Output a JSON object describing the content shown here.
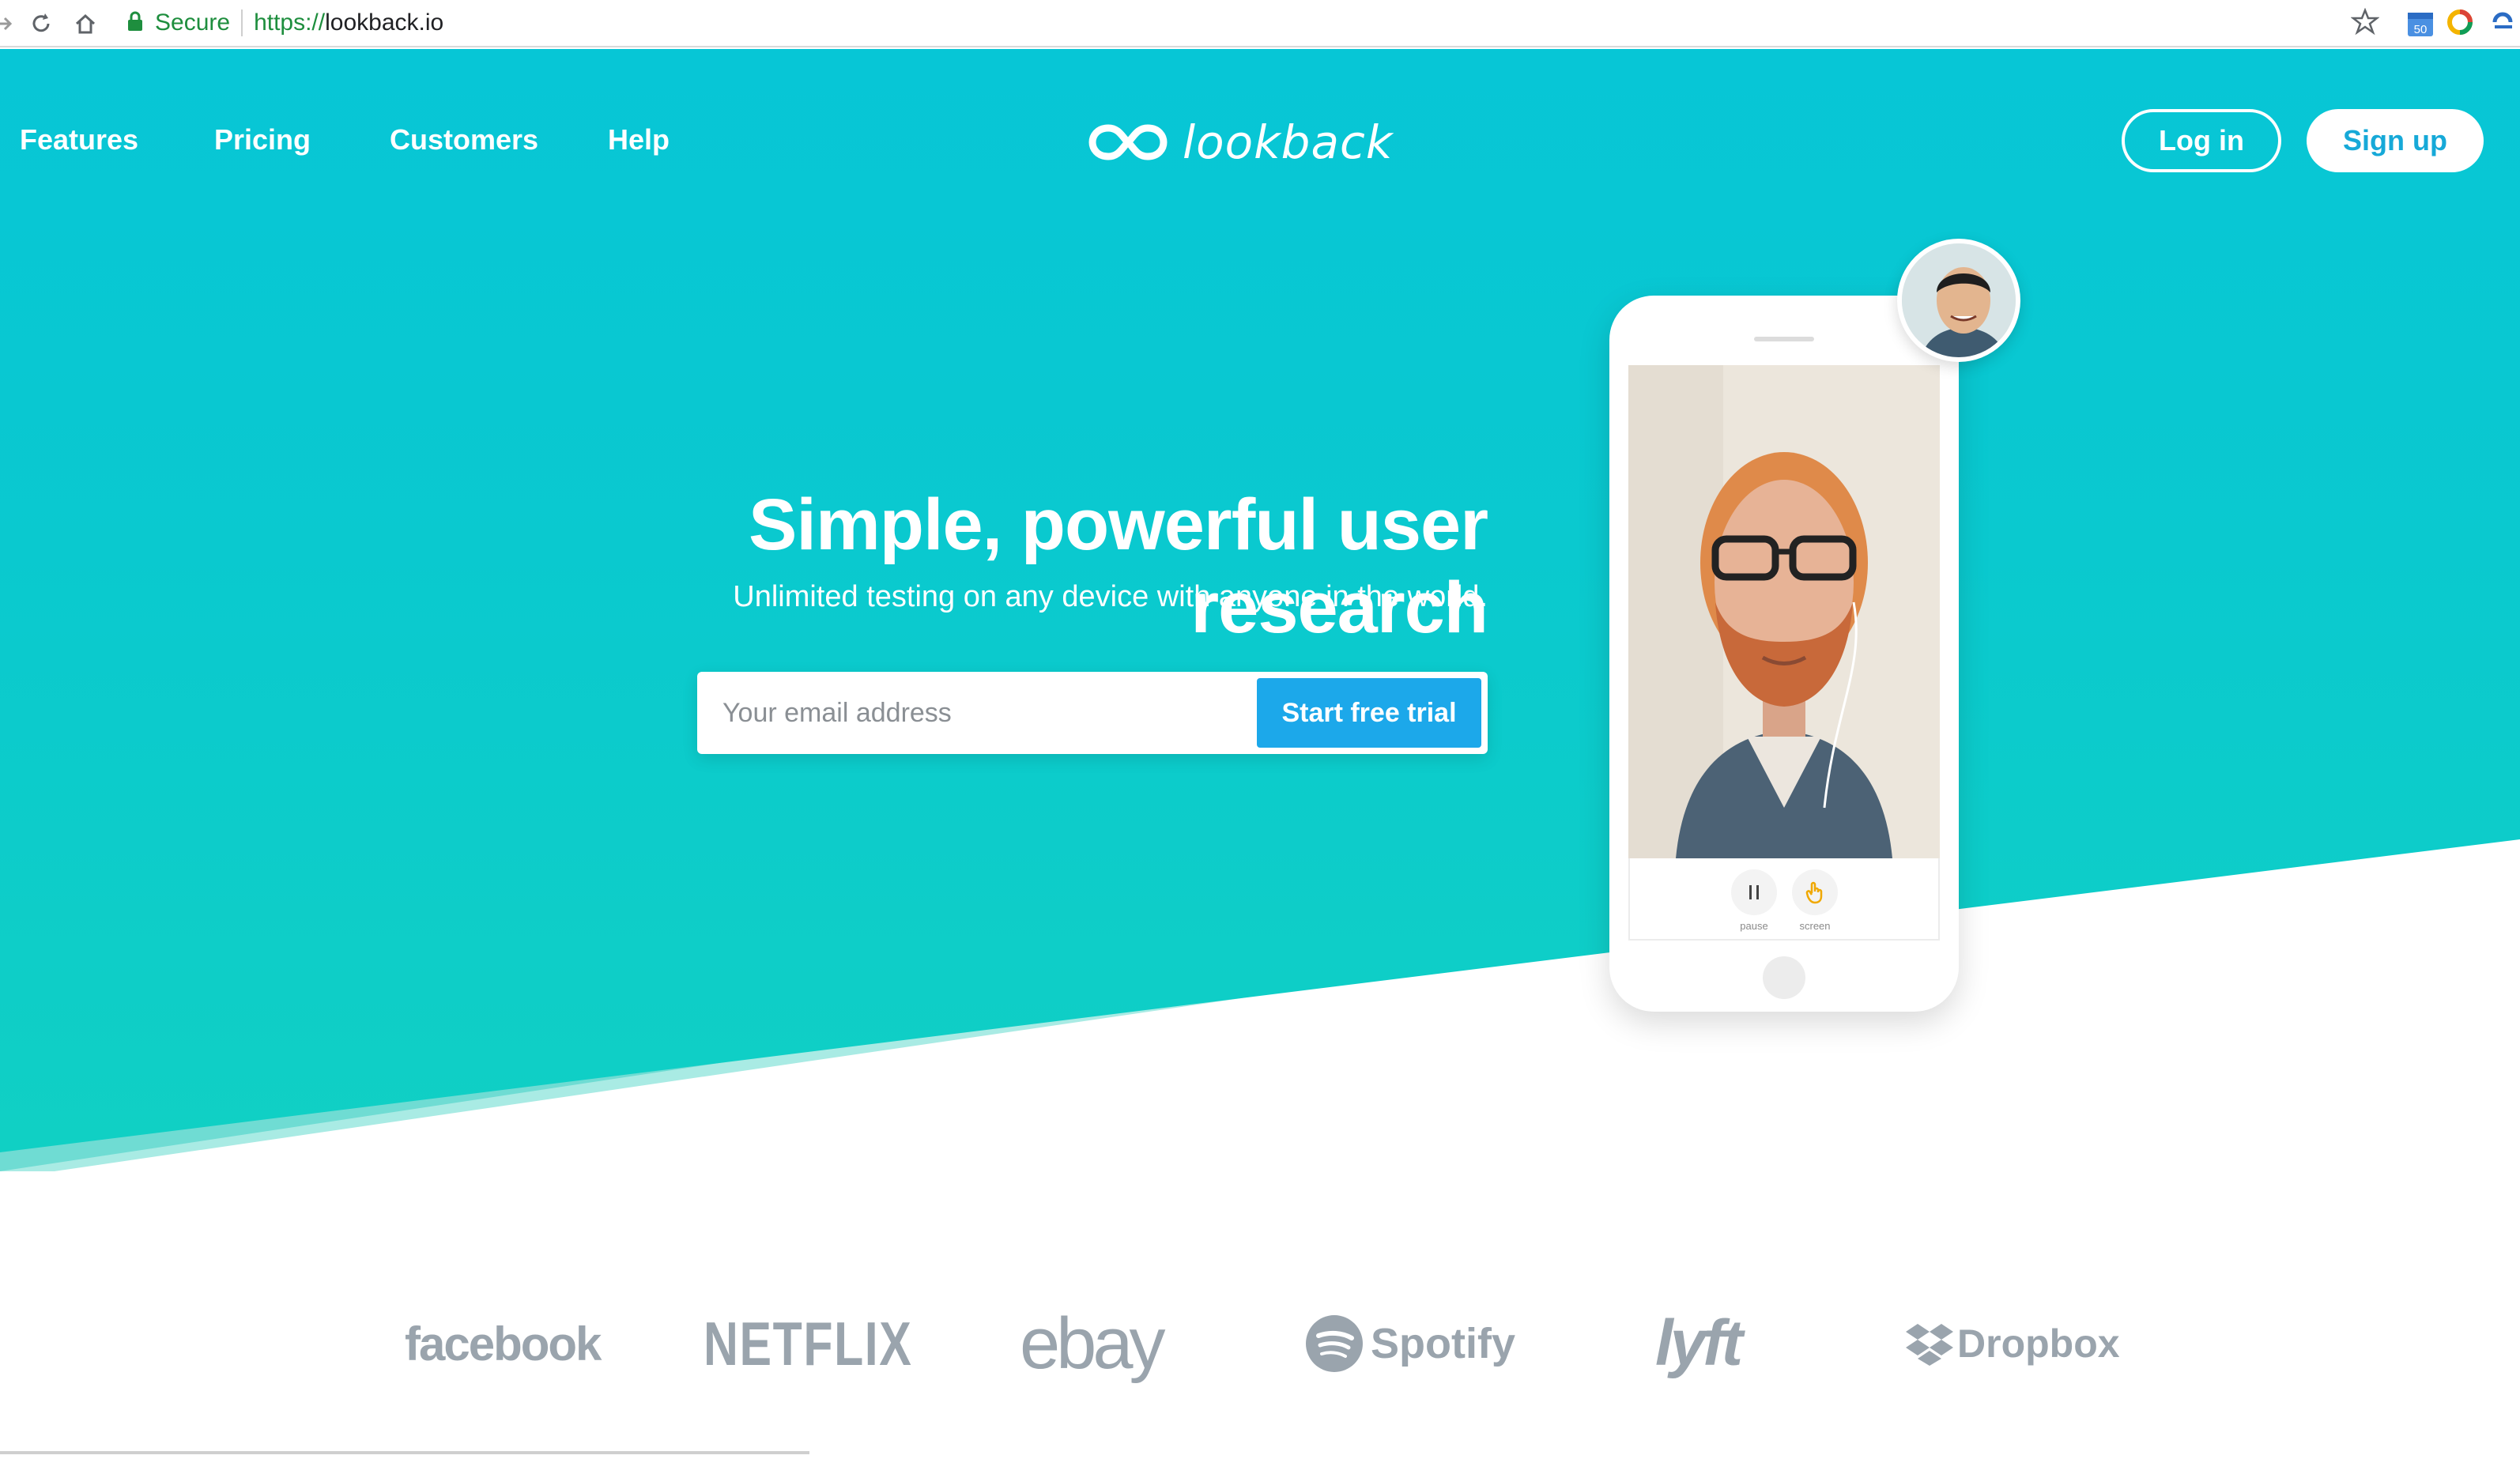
{
  "browser": {
    "secure_label": "Secure",
    "url_scheme": "https://",
    "url_host": "lookback.io",
    "extension_badge": "50"
  },
  "nav": {
    "links": [
      "Features",
      "Pricing",
      "Customers",
      "Help"
    ],
    "brand": "lookback",
    "login_label": "Log in",
    "signup_label": "Sign up"
  },
  "hero": {
    "headline": "Simple, powerful user research",
    "subheadline": "Unlimited testing on any device with anyone in the world.",
    "email_placeholder": "Your email address",
    "cta_label": "Start free trial"
  },
  "phone": {
    "pause_label": "pause",
    "screen_label": "screen"
  },
  "customers": [
    "facebook",
    "NETFLIX",
    "ebay",
    "Spotify",
    "lyft",
    "Dropbox"
  ],
  "colors": {
    "hero_top": "#07c6d6",
    "hero_bottom": "#10d0c4",
    "cta": "#1ca8ea",
    "signup_text": "#16a9d8",
    "logo_gray": "#9aa4ad"
  }
}
